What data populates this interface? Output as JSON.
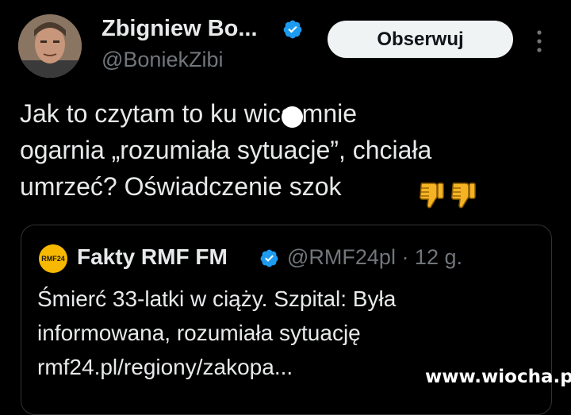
{
  "author": {
    "display_name": "Zbigniew Bo...",
    "handle": "@BoniekZibi"
  },
  "follow_label": "Obserwuj",
  "tweet": {
    "text": "Jak to czytam to ku wica mnie\nogarnia „rozumiała sytuacje”, chciała\numrzeć? Oświadczenie szok"
  },
  "emojis": [
    "thumbs-down-icon",
    "thumbs-down-icon"
  ],
  "quote": {
    "logo_text": "RMF24",
    "name": "Fakty RMF FM",
    "meta": "@RMF24pl · 12 g.",
    "text": "Śmierć 33-latki w ciąży. Szpital: Była\ninformowana, rozumiała sytuację\nrmf24.pl/regiony/zakopa..."
  },
  "watermark": "www.wiocha.pl",
  "colors": {
    "background": "#000000",
    "text_primary": "#e7e9ea",
    "text_secondary": "#71767b",
    "verified": "#1d9bf0",
    "follow_bg": "#eff3f4",
    "border": "#2f3336",
    "emoji": "#f5b324"
  }
}
